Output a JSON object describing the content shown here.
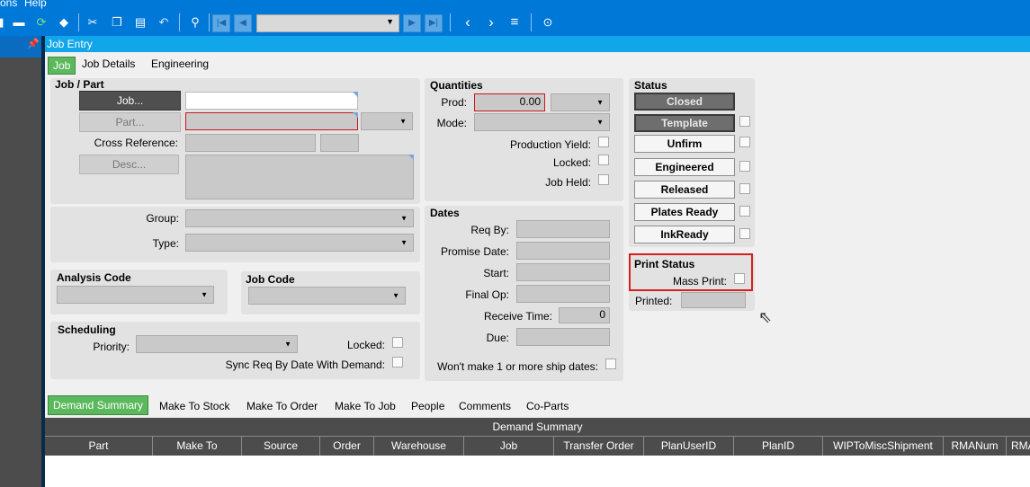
{
  "menu": {
    "items": [
      "ons",
      "Help"
    ]
  },
  "window_title": "Job Entry",
  "form_tabs": [
    "Job",
    "Job Details",
    "Engineering"
  ],
  "job_part": {
    "title": "Job / Part",
    "job_button": "Job...",
    "job_value": "",
    "part_button": "Part...",
    "cross_reference_label": "Cross Reference:",
    "desc_button": "Desc..."
  },
  "group_type": {
    "group_label": "Group:",
    "type_label": "Type:"
  },
  "analysis_code": {
    "title": "Analysis Code"
  },
  "job_code": {
    "title": "Job Code"
  },
  "scheduling": {
    "title": "Scheduling",
    "priority_label": "Priority:",
    "locked_label": "Locked:",
    "sync_label": "Sync Req By Date With Demand:"
  },
  "quantities": {
    "title": "Quantities",
    "prod_label": "Prod:",
    "prod_value": "0.00",
    "mode_label": "Mode:",
    "production_yield_label": "Production Yield:",
    "locked_label": "Locked:",
    "job_held_label": "Job Held:"
  },
  "dates": {
    "title": "Dates",
    "req_by_label": "Req By:",
    "promise_date_label": "Promise Date:",
    "start_label": "Start:",
    "final_op_label": "Final Op:",
    "receive_time_label": "Receive Time:",
    "receive_time_value": "0",
    "due_label": "Due:",
    "wont_make_label": "Won't make 1 or more ship dates:"
  },
  "status": {
    "title": "Status",
    "buttons": [
      "Closed",
      "Template",
      "Unfirm",
      "Engineered",
      "Released",
      "Plates Ready",
      "InkReady"
    ]
  },
  "print_status": {
    "title": "Print Status",
    "mass_print_label": "Mass Print:",
    "printed_label": "Printed:"
  },
  "bottom_tabs": [
    "Demand Summary",
    "Make To Stock",
    "Make To Order",
    "Make To Job",
    "People",
    "Comments",
    "Co-Parts"
  ],
  "grid": {
    "title": "Demand Summary",
    "columns": [
      "Part",
      "Make To",
      "Source",
      "Order",
      "Warehouse",
      "Job",
      "Transfer Order",
      "PlanUserID",
      "PlanID",
      "WIPToMiscShipment",
      "RMANum",
      "RMA"
    ]
  },
  "colors": {
    "accent": "#0078d7",
    "title_bar": "#11a5e9",
    "active_tab": "#5cb85c",
    "highlight": "#d81e1e",
    "grid_header": "#4c4c4c"
  }
}
